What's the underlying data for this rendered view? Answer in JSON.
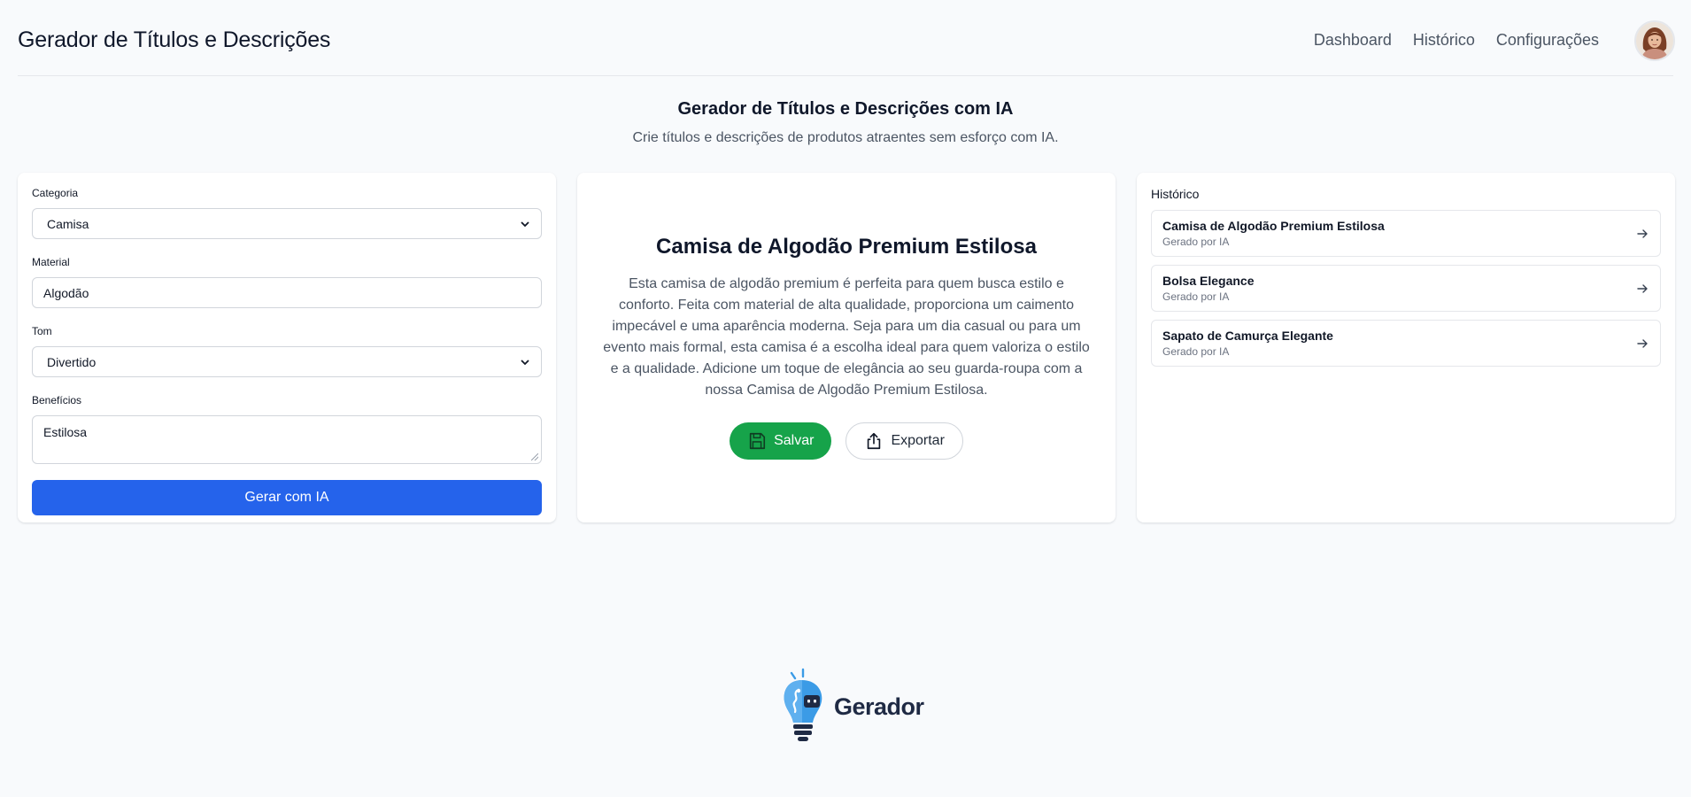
{
  "header": {
    "title": "Gerador de Títulos e Descrições",
    "nav": [
      "Dashboard",
      "Histórico",
      "Configurações"
    ]
  },
  "hero": {
    "title": "Gerador de Títulos e Descrições com IA",
    "subtitle": "Crie títulos e descrições de produtos atraentes sem esforço com IA."
  },
  "form": {
    "category_label": "Categoria",
    "category_value": "Camisa",
    "material_label": "Material",
    "material_value": "Algodão",
    "tone_label": "Tom",
    "tone_value": "Divertido",
    "benefits_label": "Benefícios",
    "benefits_value": "Estilosa",
    "generate_label": "Gerar com IA"
  },
  "result": {
    "title": "Camisa de Algodão Premium Estilosa",
    "description": "Esta camisa de algodão premium é perfeita para quem busca estilo e conforto. Feita com material de alta qualidade, proporciona um caimento impecável e uma aparência moderna. Seja para um dia casual ou para um evento mais formal, esta camisa é a escolha ideal para quem valoriza o estilo e a qualidade. Adicione um toque de elegância ao seu guarda-roupa com a nossa Camisa de Algodão Premium Estilosa.",
    "save_label": "Salvar",
    "export_label": "Exportar"
  },
  "history": {
    "heading": "Histórico",
    "items": [
      {
        "title": "Camisa de Algodão Premium Estilosa",
        "subtitle": "Gerado por IA"
      },
      {
        "title": "Bolsa Elegance",
        "subtitle": "Gerado por IA"
      },
      {
        "title": "Sapato de Camurça Elegante",
        "subtitle": "Gerado por IA"
      }
    ]
  },
  "footer": {
    "brand": "Gerador"
  },
  "colors": {
    "primary": "#2563eb",
    "success": "#16a34a",
    "background": "#f8fafc",
    "brand_blue": "#3b9be6"
  },
  "icons": [
    "user-avatar",
    "chevron-down-icon",
    "save-icon",
    "share-icon",
    "arrow-right-icon",
    "lightbulb-robot-logo"
  ]
}
